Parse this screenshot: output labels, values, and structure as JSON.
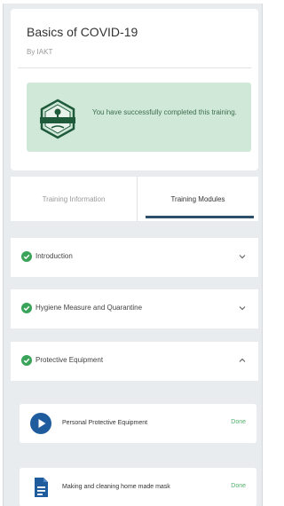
{
  "course": {
    "title": "Basics of COVID-19",
    "author": "By IAKT"
  },
  "banner": {
    "message": "You have successfully completed this training.",
    "icon": "certificate-badge-icon"
  },
  "tabs": [
    {
      "label": "Training Information",
      "active": false
    },
    {
      "label": "Training Modules",
      "active": true
    }
  ],
  "sections": [
    {
      "label": "Introduction",
      "completed": true,
      "expanded": false
    },
    {
      "label": "Hygiene Measure and Quarantine",
      "completed": true,
      "expanded": false
    },
    {
      "label": "Protective Equipment",
      "completed": true,
      "expanded": true
    }
  ],
  "modules": [
    {
      "label": "Personal Protective Equipment",
      "status": "Done",
      "icon": "play-video-icon"
    },
    {
      "label": "Making and cleaning home made mask",
      "status": "Done",
      "icon": "document-icon"
    }
  ],
  "colors": {
    "banner_bg": "#cfe8d8",
    "success_green": "#3aa35a",
    "primary_blue": "#1f5c9e",
    "tab_underline": "#2d4f6a"
  }
}
